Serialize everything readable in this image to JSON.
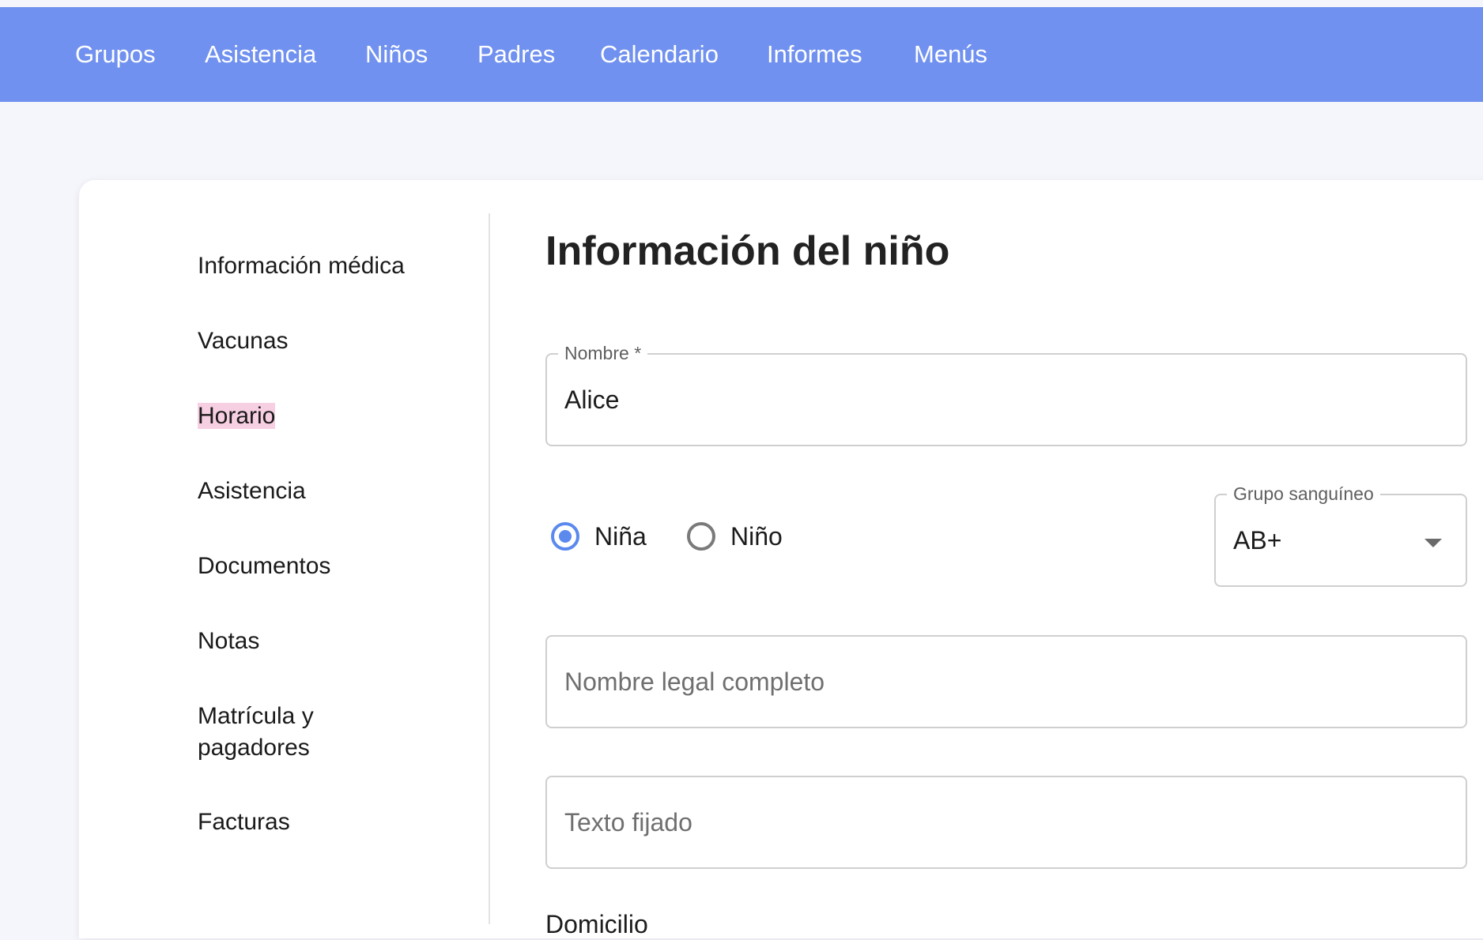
{
  "nav": {
    "items": [
      {
        "label": "Grupos"
      },
      {
        "label": "Asistencia"
      },
      {
        "label": "Niños"
      },
      {
        "label": "Padres"
      },
      {
        "label": "Calendario"
      },
      {
        "label": "Informes"
      },
      {
        "label": "Menús"
      }
    ]
  },
  "sidebar": {
    "items": [
      {
        "label": "Información médica"
      },
      {
        "label": "Vacunas"
      },
      {
        "label": "Horario",
        "active": true
      },
      {
        "label": "Asistencia"
      },
      {
        "label": "Documentos"
      },
      {
        "label": "Notas"
      },
      {
        "label": "Matrícula y pagadores"
      },
      {
        "label": "Facturas"
      }
    ]
  },
  "main": {
    "title": "Información del niño",
    "nombre": {
      "label": "Nombre *",
      "value": "Alice"
    },
    "gender": {
      "options": [
        {
          "label": "Niña",
          "checked": true
        },
        {
          "label": "Niño",
          "checked": false
        }
      ]
    },
    "blood_type": {
      "label": "Grupo sanguíneo",
      "value": "AB+"
    },
    "legal_name": {
      "placeholder": "Nombre legal completo"
    },
    "pinned_text": {
      "placeholder": "Texto fijado"
    },
    "next_section_label": "Domicilio"
  },
  "colors": {
    "topbar": "#7091ef",
    "accent": "#5b89ee",
    "highlight": "#f7cfe2",
    "background": "#f4f6fb"
  }
}
